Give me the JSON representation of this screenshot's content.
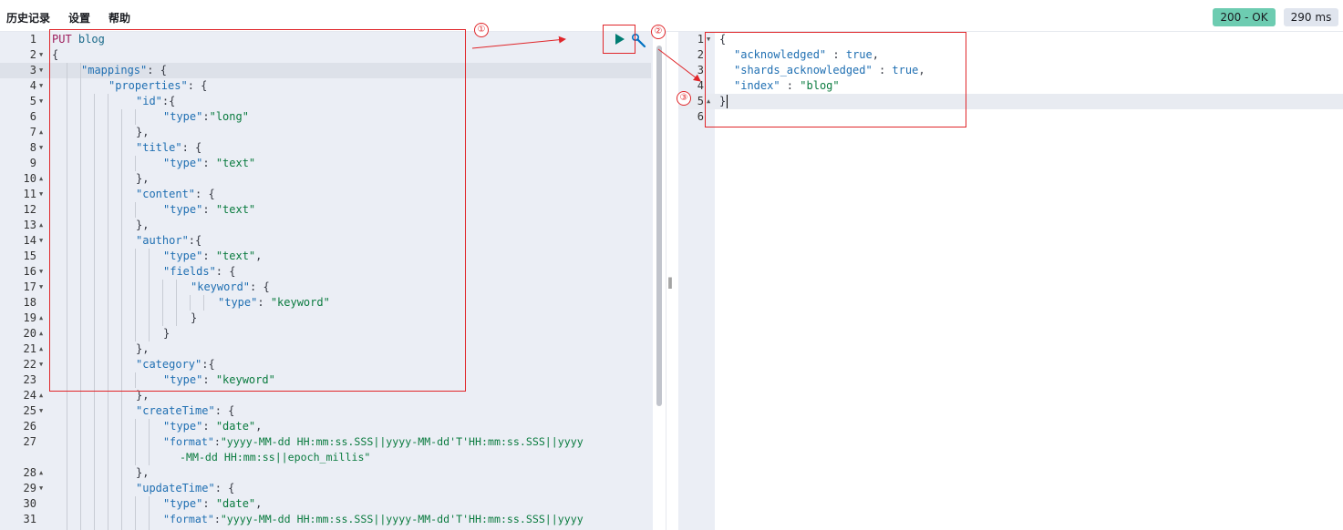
{
  "menu": {
    "history": "历史记录",
    "settings": "设置",
    "help": "帮助"
  },
  "status": {
    "code": "200 - OK",
    "time": "290 ms"
  },
  "annotations": {
    "n1": "①",
    "n2": "②",
    "n3": "③"
  },
  "request": {
    "lines": [
      {
        "n": "1",
        "fold": ""
      },
      {
        "n": "2",
        "fold": "down"
      },
      {
        "n": "3",
        "fold": "down"
      },
      {
        "n": "4",
        "fold": "down"
      },
      {
        "n": "5",
        "fold": "down"
      },
      {
        "n": "6",
        "fold": ""
      },
      {
        "n": "7",
        "fold": "up"
      },
      {
        "n": "8",
        "fold": "down"
      },
      {
        "n": "9",
        "fold": ""
      },
      {
        "n": "10",
        "fold": "up"
      },
      {
        "n": "11",
        "fold": "down"
      },
      {
        "n": "12",
        "fold": ""
      },
      {
        "n": "13",
        "fold": "up"
      },
      {
        "n": "14",
        "fold": "down"
      },
      {
        "n": "15",
        "fold": ""
      },
      {
        "n": "16",
        "fold": "down"
      },
      {
        "n": "17",
        "fold": "down"
      },
      {
        "n": "18",
        "fold": ""
      },
      {
        "n": "19",
        "fold": "up"
      },
      {
        "n": "20",
        "fold": "up"
      },
      {
        "n": "21",
        "fold": "up"
      },
      {
        "n": "22",
        "fold": "down"
      },
      {
        "n": "23",
        "fold": ""
      },
      {
        "n": "24",
        "fold": "up"
      },
      {
        "n": "25",
        "fold": "down"
      },
      {
        "n": "26",
        "fold": ""
      },
      {
        "n": "27",
        "fold": ""
      },
      {
        "n": "",
        "fold": ""
      },
      {
        "n": "28",
        "fold": "up"
      },
      {
        "n": "29",
        "fold": "down"
      },
      {
        "n": "30",
        "fold": ""
      },
      {
        "n": "31",
        "fold": ""
      }
    ],
    "text": {
      "l1_method": "PUT",
      "l1_url": " blog",
      "l2": "{",
      "l3_key": "\"mappings\"",
      "l3_rest": ": {",
      "l4_key": "\"properties\"",
      "l4_rest": ": {",
      "l5_key": "\"id\"",
      "l5_rest": ":{",
      "l6_key": "\"type\"",
      "l6_colon": ":",
      "l6_val": "\"long\"",
      "l7": "},",
      "l8_key": "\"title\"",
      "l8_rest": ": {",
      "l9_key": "\"type\"",
      "l9_colon": ": ",
      "l9_val": "\"text\"",
      "l10": "},",
      "l11_key": "\"content\"",
      "l11_rest": ": {",
      "l12_key": "\"type\"",
      "l12_colon": ": ",
      "l12_val": "\"text\"",
      "l13": "},",
      "l14_key": "\"author\"",
      "l14_rest": ":{",
      "l15_key": "\"type\"",
      "l15_colon": ": ",
      "l15_val": "\"text\"",
      "l15_end": ",",
      "l16_key": "\"fields\"",
      "l16_rest": ": {",
      "l17_key": "\"keyword\"",
      "l17_rest": ": {",
      "l18_key": "\"type\"",
      "l18_colon": ": ",
      "l18_val": "\"keyword\"",
      "l19": "}",
      "l20": "}",
      "l21": "},",
      "l22_key": "\"category\"",
      "l22_rest": ":{",
      "l23_key": "\"type\"",
      "l23_colon": ": ",
      "l23_val": "\"keyword\"",
      "l24": "},",
      "l25_key": "\"createTime\"",
      "l25_rest": ": {",
      "l26_key": "\"type\"",
      "l26_colon": ": ",
      "l26_val": "\"date\"",
      "l26_end": ",",
      "l27_key": "\"format\"",
      "l27_colon": ":",
      "l27_val": "\"yyyy-MM-dd HH:mm:ss.SSS||yyyy-MM-dd'T'HH:mm:ss.SSS||yyyy",
      "l27b_val": "-MM-dd HH:mm:ss||epoch_millis\"",
      "l28": "},",
      "l29_key": "\"updateTime\"",
      "l29_rest": ": {",
      "l30_key": "\"type\"",
      "l30_colon": ": ",
      "l30_val": "\"date\"",
      "l30_end": ",",
      "l31_key": "\"format\"",
      "l31_colon": ":",
      "l31_val": "\"yyyy-MM-dd HH:mm:ss.SSS||yyyy-MM-dd'T'HH:mm:ss.SSS||yyyy"
    }
  },
  "response": {
    "line_numbers": [
      "1",
      "2",
      "3",
      "4",
      "5",
      "6"
    ],
    "l1": "{",
    "l2_key": "\"acknowledged\"",
    "l2_colon": " : ",
    "l2_val": "true",
    "l2_end": ",",
    "l3_key": "\"shards_acknowledged\"",
    "l3_colon": " : ",
    "l3_val": "true",
    "l3_end": ",",
    "l4_key": "\"index\"",
    "l4_colon": " : ",
    "l4_val": "\"blog\"",
    "l5": "}"
  },
  "splitter_glyph": "‖"
}
